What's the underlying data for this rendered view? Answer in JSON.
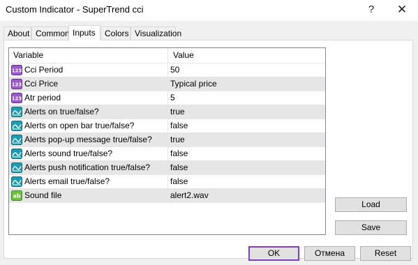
{
  "window": {
    "title": "Custom Indicator - SuperTrend cci",
    "help_label": "?",
    "close_label": "✕"
  },
  "tabs": [
    {
      "label": "About"
    },
    {
      "label": "Common"
    },
    {
      "label": "Inputs"
    },
    {
      "label": "Colors"
    },
    {
      "label": "Visualization"
    }
  ],
  "active_tab": "Inputs",
  "grid": {
    "headers": {
      "variable": "Variable",
      "value": "Value"
    },
    "rows": [
      {
        "icon": "numeric-icon",
        "variable": "Cci Period",
        "value": "50"
      },
      {
        "icon": "numeric-icon",
        "variable": "Cci Price",
        "value": "Typical price"
      },
      {
        "icon": "numeric-icon",
        "variable": "Atr period",
        "value": "5"
      },
      {
        "icon": "boolean-icon",
        "variable": "Alerts on true/false?",
        "value": "true"
      },
      {
        "icon": "boolean-icon",
        "variable": "Alerts on open bar true/false?",
        "value": "false"
      },
      {
        "icon": "boolean-icon",
        "variable": "Alerts pop-up message true/false?",
        "value": "true"
      },
      {
        "icon": "boolean-icon",
        "variable": "Alerts sound true/false?",
        "value": "false"
      },
      {
        "icon": "boolean-icon",
        "variable": "Alerts push notification true/false?",
        "value": "false"
      },
      {
        "icon": "boolean-icon",
        "variable": "Alerts email true/false?",
        "value": "false"
      },
      {
        "icon": "string-icon",
        "variable": "Sound file",
        "value": "alert2.wav"
      }
    ]
  },
  "side_buttons": {
    "load": "Load",
    "save": "Save"
  },
  "footer_buttons": {
    "ok": "OK",
    "cancel": "Отмена",
    "reset": "Reset"
  },
  "colors": {
    "accent_border": "#7f3fbf",
    "numeric_icon": "#9b59c6",
    "boolean_icon": "#1e9bb0",
    "string_icon": "#6fbf3f"
  }
}
